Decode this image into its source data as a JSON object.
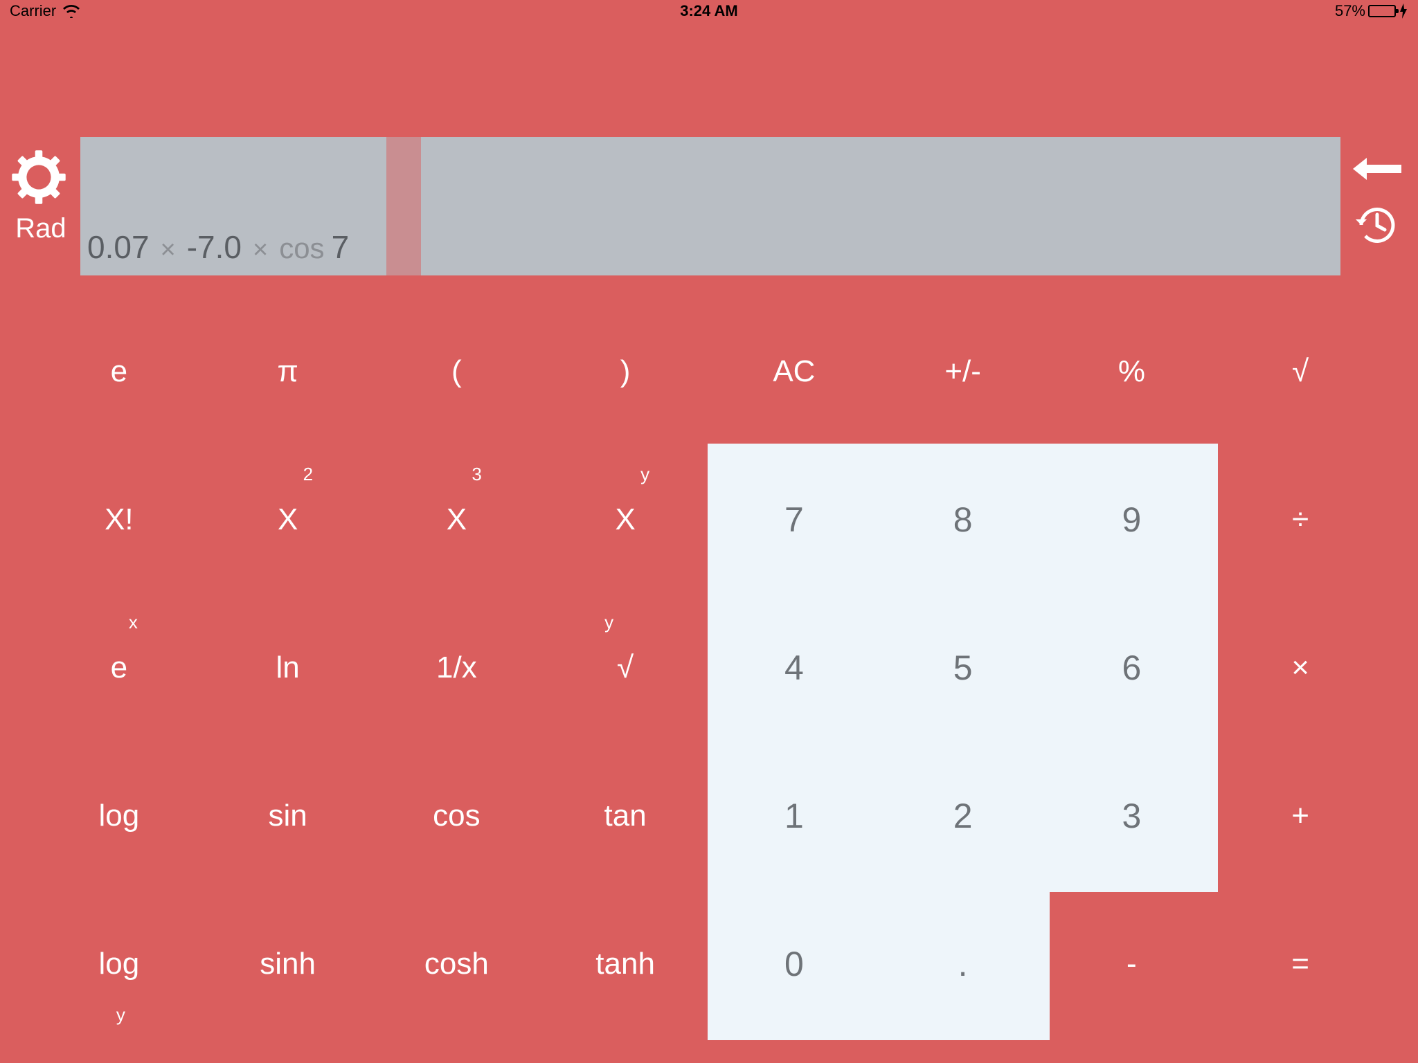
{
  "status": {
    "carrier": "Carrier",
    "time": "3:24 AM",
    "battery_pct": "57%"
  },
  "mode": "Rad",
  "expression": {
    "a": "0.07",
    "op1": "×",
    "b": "-7.0",
    "op2": "×",
    "fn": "cos",
    "c": "7"
  },
  "keys": {
    "r1": [
      "e",
      "π",
      "(",
      ")",
      "AC",
      "+/-",
      "%",
      "√"
    ],
    "r2": [
      "X!",
      "X",
      "X",
      "X",
      "7",
      "8",
      "9",
      "÷"
    ],
    "r2_sup": [
      "",
      "2",
      "3",
      "y",
      "",
      "",
      "",
      ""
    ],
    "r3": [
      "e",
      "ln",
      "1/x",
      "√",
      "4",
      "5",
      "6",
      "×"
    ],
    "r3_sup": [
      "x",
      "",
      "",
      "y",
      "",
      "",
      "",
      ""
    ],
    "r4": [
      "log",
      "sin",
      "cos",
      "tan",
      "1",
      "2",
      "3",
      "+"
    ],
    "r5": [
      "log",
      "sinh",
      "cosh",
      "tanh",
      "0",
      ".",
      "-",
      "="
    ],
    "r5_sub": [
      "y",
      "",
      "",
      "",
      "",
      "",
      "",
      ""
    ]
  }
}
